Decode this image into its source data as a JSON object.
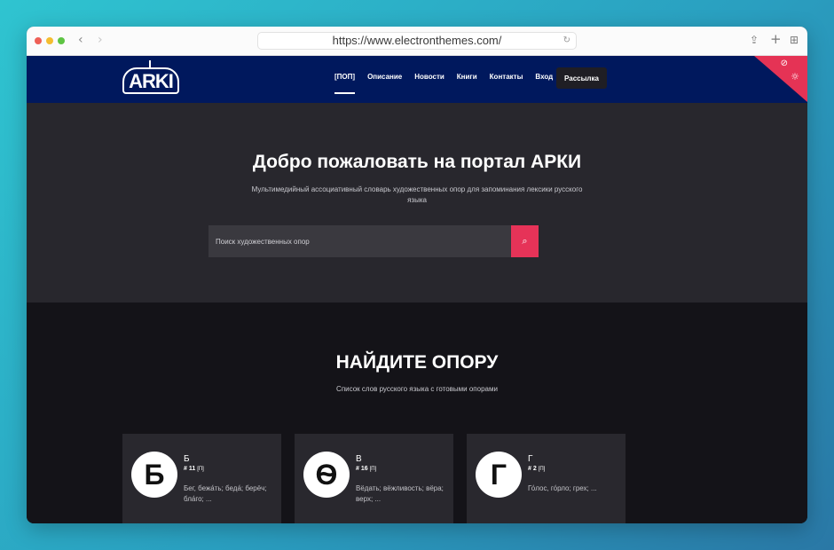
{
  "browser": {
    "url": "https://www.electronthemes.com/"
  },
  "header": {
    "logo_text": "ARKI",
    "nav": [
      {
        "label": "[ПОП]"
      },
      {
        "label": "Описание"
      },
      {
        "label": "Новости"
      },
      {
        "label": "Книги"
      },
      {
        "label": "Контакты"
      },
      {
        "label": "Вход"
      }
    ],
    "subscribe_label": "Рассылка"
  },
  "hero": {
    "title": "Добро пожаловать на портал АРКИ",
    "subtitle": "Мультимедийный ассоциативный словарь художественных опор для запоминания лексики русского языка",
    "search_placeholder": "Поиск художественных опор"
  },
  "section": {
    "title": "НАЙДИТЕ ОПОРУ",
    "subtitle": "Список слов русского языка с готовыми опорами",
    "cards": [
      {
        "glyph": "Б",
        "letter": "Б",
        "count": "# 11",
        "count_unit": "[П]",
        "words": "Бег, бежа́ть; беда́; берёч; бла́го; ..."
      },
      {
        "glyph": "Ѳ",
        "letter": "В",
        "count": "# 16",
        "count_unit": "[П]",
        "words": "Вёдать; вёжливость; вёра; верх; ..."
      },
      {
        "glyph": "Г",
        "letter": "Г",
        "count": "# 2",
        "count_unit": "[П]",
        "words": "Го́лос, го́рло; грех; ..."
      }
    ]
  },
  "colors": {
    "header_bg": "#00185d",
    "accent": "#e63358",
    "hero_bg": "#28272d",
    "page_bg": "#141318",
    "card_bg": "#29282e"
  }
}
